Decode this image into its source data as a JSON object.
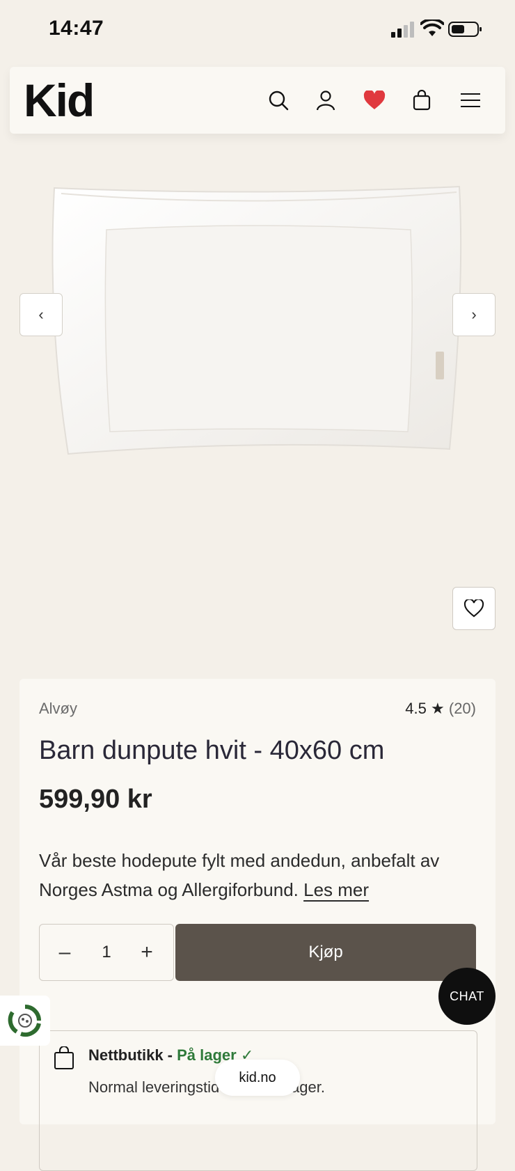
{
  "status_bar": {
    "time": "14:47"
  },
  "header": {
    "logo": "Kid",
    "icons": [
      "search-icon",
      "user-icon",
      "heart-icon",
      "bag-icon",
      "menu-icon"
    ],
    "heart_color": "#e0393e"
  },
  "gallery": {
    "prev_glyph": "‹",
    "next_glyph": "›"
  },
  "product": {
    "brand": "Alvøy",
    "rating": "4.5",
    "rating_star": "★",
    "review_count": "(20)",
    "title": "Barn dunpute hvit - 40x60 cm",
    "price": "599,90 kr",
    "description": "Vår beste hodepute fylt med andedun, anbefalt av Norges Astma og Allergiforbund.",
    "read_more": "Les mer",
    "quantity": "1",
    "minus_glyph": "–",
    "plus_glyph": "+",
    "buy_label": "Kjøp",
    "buy_color": "#5b534b"
  },
  "stock": {
    "store_label": "Nettbutikk - ",
    "status": "På lager",
    "status_mark": "✓",
    "status_color": "#2f7a3a",
    "delivery": "Normal leveringstid 2-5 virkedager."
  },
  "chat": {
    "label": "CHAT"
  },
  "browser": {
    "url": "kid.no"
  }
}
